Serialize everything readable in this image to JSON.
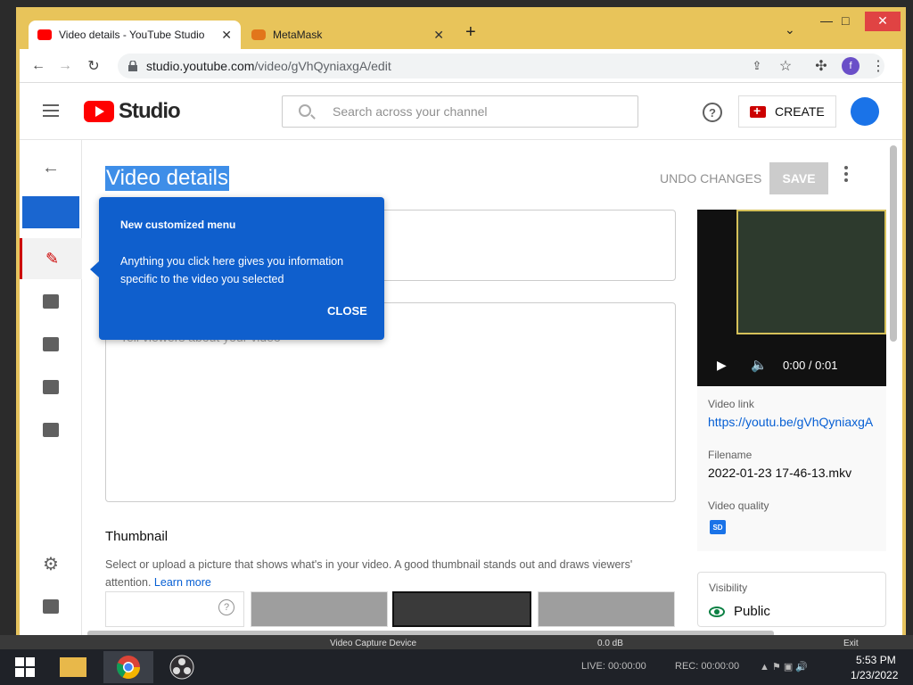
{
  "browser": {
    "tabs": [
      {
        "title": "Video details - YouTube Studio"
      },
      {
        "title": "MetaMask"
      }
    ],
    "url_host": "studio.youtube.com",
    "url_path": "/video/gVhQyniaxgA/edit",
    "profile_initial": "f"
  },
  "studio": {
    "logo_text": "Studio",
    "search_placeholder": "Search across your channel",
    "help": "?",
    "create_label": "CREATE",
    "page_title": "Video details",
    "undo_label": "UNDO CHANGES",
    "save_label": "SAVE",
    "description_placeholder": "Tell viewers about your video",
    "thumbnail_title": "Thumbnail",
    "thumbnail_desc": "Select or upload a picture that shows what's in your video. A good thumbnail stands out and draws viewers' attention.",
    "learn_more": "Learn more"
  },
  "tooltip": {
    "title": "New customized menu",
    "body": "Anything you click here gives you information specific to the video you selected",
    "close": "CLOSE"
  },
  "video_panel": {
    "time": "0:00 / 0:01",
    "link_label": "Video link",
    "link": "https://youtu.be/gVhQyniaxgA",
    "filename_label": "Filename",
    "filename": "2022-01-23 17-46-13.mkv",
    "quality_label": "Video quality",
    "quality_badge": "SD",
    "visibility_label": "Visibility",
    "visibility": "Public"
  },
  "obs": {
    "source": "Video Capture Device",
    "db": "0.0 dB",
    "exit": "Exit",
    "live": "LIVE: 00:00:00",
    "rec": "REC: 00:00:00"
  },
  "clock": {
    "time": "5:53 PM",
    "date": "1/23/2022"
  }
}
